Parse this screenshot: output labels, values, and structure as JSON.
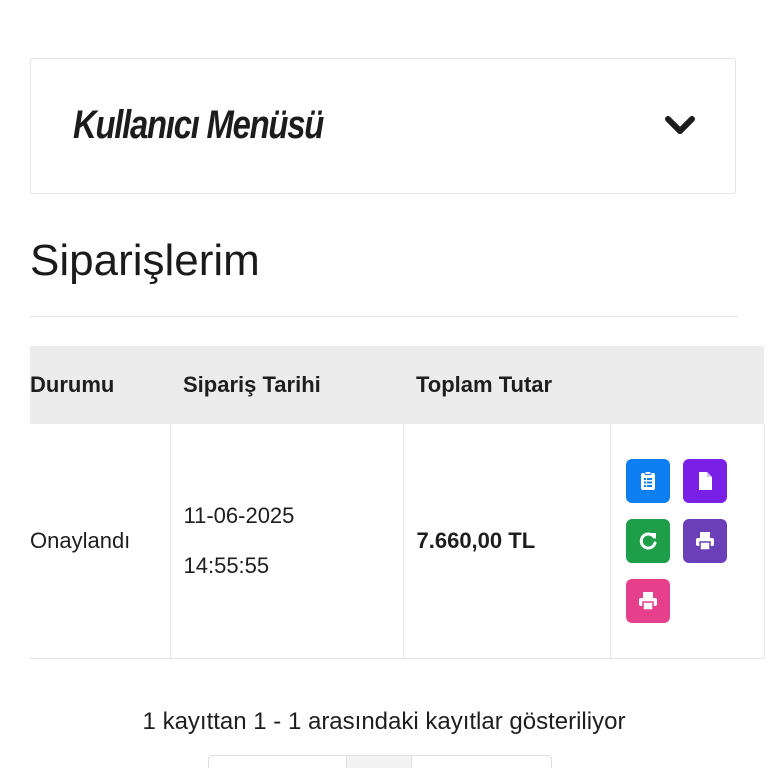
{
  "user_menu": {
    "title": "Kullanıcı Menüsü",
    "toggle_icon": "chevron-down-icon"
  },
  "page": {
    "title": "Siparişlerim"
  },
  "table": {
    "headers": [
      "Durumu",
      "Sipariş Tarihi",
      "Toplam Tutar",
      ""
    ],
    "rows": [
      {
        "status": "Onaylandı",
        "date": "11-06-2025",
        "time": "14:55:55",
        "total": "7.660,00 TL",
        "actions": [
          {
            "icon": "order-details-icon",
            "color": "#0d7ff2"
          },
          {
            "icon": "invoice-document-icon",
            "color": "#7a1fe6"
          },
          {
            "icon": "refresh-icon",
            "color": "#1f9e4a"
          },
          {
            "icon": "print-icon",
            "color": "#6a3fb8"
          },
          {
            "icon": "print-icon",
            "color": "#e6408c"
          }
        ]
      }
    ]
  },
  "footer": {
    "records_info": "1 kayıttan 1 - 1 arasındaki kayıtlar gösteriliyor"
  }
}
